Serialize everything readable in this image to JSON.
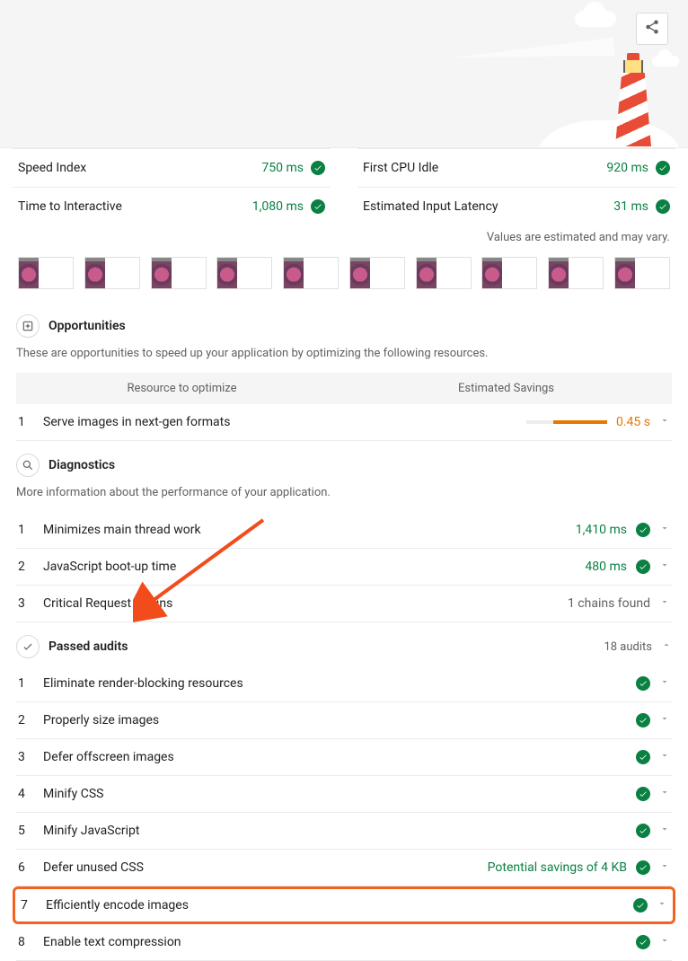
{
  "metrics": [
    {
      "label": "Speed Index",
      "value": "750 ms"
    },
    {
      "label": "First CPU Idle",
      "value": "920 ms"
    },
    {
      "label": "Time to Interactive",
      "value": "1,080 ms"
    },
    {
      "label": "Estimated Input Latency",
      "value": "31 ms"
    }
  ],
  "note": "Values are estimated and may vary.",
  "opportunities": {
    "title": "Opportunities",
    "subtitle": "These are opportunities to speed up your application by optimizing the following resources.",
    "col1": "Resource to optimize",
    "col2": "Estimated Savings",
    "rows": [
      {
        "num": "1",
        "label": "Serve images in next-gen formats",
        "value": "0.45 s"
      }
    ]
  },
  "diagnostics": {
    "title": "Diagnostics",
    "subtitle": "More information about the performance of your application.",
    "rows": [
      {
        "num": "1",
        "label": "Minimizes main thread work",
        "value": "1,410 ms",
        "style": "green",
        "pass": true
      },
      {
        "num": "2",
        "label": "JavaScript boot-up time",
        "value": "480 ms",
        "style": "green",
        "pass": true
      },
      {
        "num": "3",
        "label": "Critical Request Chains",
        "value": "1 chains found",
        "style": "grey",
        "pass": false
      }
    ]
  },
  "passed": {
    "title": "Passed audits",
    "count": "18 audits",
    "rows": [
      {
        "num": "1",
        "label": "Eliminate render-blocking resources",
        "value": "",
        "highlight": false
      },
      {
        "num": "2",
        "label": "Properly size images",
        "value": "",
        "highlight": false
      },
      {
        "num": "3",
        "label": "Defer offscreen images",
        "value": "",
        "highlight": false
      },
      {
        "num": "4",
        "label": "Minify CSS",
        "value": "",
        "highlight": false
      },
      {
        "num": "5",
        "label": "Minify JavaScript",
        "value": "",
        "highlight": false
      },
      {
        "num": "6",
        "label": "Defer unused CSS",
        "value": "Potential savings of 4 KB",
        "highlight": false
      },
      {
        "num": "7",
        "label": "Efficiently encode images",
        "value": "",
        "highlight": true
      },
      {
        "num": "8",
        "label": "Enable text compression",
        "value": "",
        "highlight": false
      }
    ]
  }
}
